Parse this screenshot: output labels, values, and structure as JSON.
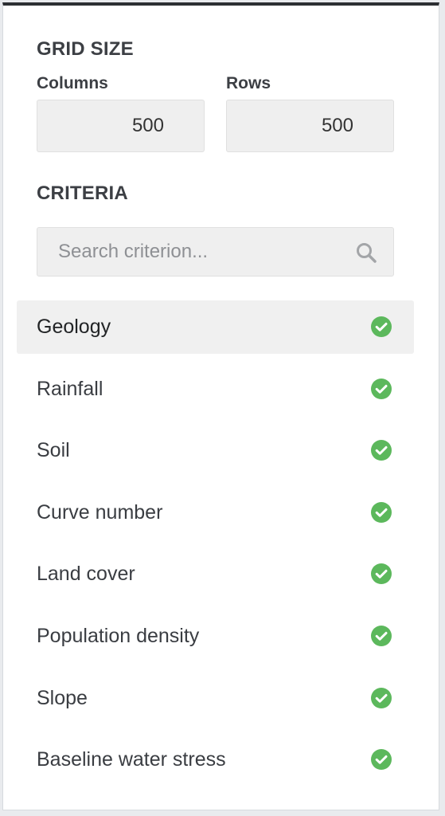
{
  "grid_size": {
    "title": "GRID SIZE",
    "columns_label": "Columns",
    "columns_value": "500",
    "rows_label": "Rows",
    "rows_value": "500"
  },
  "criteria": {
    "title": "CRITERIA",
    "search_placeholder": "Search criterion...",
    "search_icon": "search-icon",
    "status_icon": "check-circle-icon",
    "status_color": "#5cb85c",
    "selected_item": "Geology",
    "items": [
      {
        "label": "Geology",
        "selected": true,
        "status": "complete"
      },
      {
        "label": "Rainfall",
        "selected": false,
        "status": "complete"
      },
      {
        "label": "Soil",
        "selected": false,
        "status": "complete"
      },
      {
        "label": "Curve number",
        "selected": false,
        "status": "complete"
      },
      {
        "label": "Land cover",
        "selected": false,
        "status": "complete"
      },
      {
        "label": "Population density",
        "selected": false,
        "status": "complete"
      },
      {
        "label": "Slope",
        "selected": false,
        "status": "complete"
      },
      {
        "label": "Baseline water stress",
        "selected": false,
        "status": "complete"
      }
    ]
  }
}
